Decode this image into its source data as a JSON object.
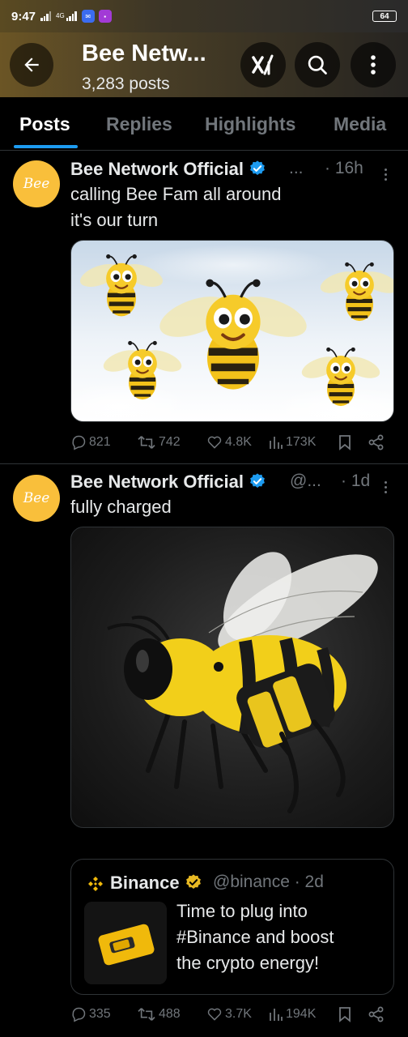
{
  "status_bar": {
    "time": "9:47",
    "network": "4G",
    "battery": "64"
  },
  "header": {
    "title": "Bee Netw...",
    "subtitle": "3,283 posts"
  },
  "tabs": [
    "Posts",
    "Replies",
    "Highlights",
    "Media"
  ],
  "posts": [
    {
      "author": "Bee Network Official",
      "handle": "...",
      "time": "· 16h",
      "text": "calling Bee Fam all around\nit's our turn",
      "avatar_text": "Bee",
      "stats": {
        "replies": "821",
        "reposts": "742",
        "likes": "4.8K",
        "views": "173K"
      }
    },
    {
      "author": "Bee Network Official",
      "handle": "@...",
      "time": "· 1d",
      "text": "fully charged",
      "avatar_text": "Bee",
      "quote": {
        "author": "Binance",
        "handle": "@binance · 2d",
        "text": "Time to plug into\n#Binance and boost\nthe crypto energy!"
      },
      "stats": {
        "replies": "335",
        "reposts": "488",
        "likes": "3.7K",
        "views": "194K"
      }
    }
  ],
  "colors": {
    "accent": "#1d9bf0",
    "bee_yellow": "#f9bf3b",
    "binance_gold": "#f0b90b",
    "muted": "#71767b"
  }
}
